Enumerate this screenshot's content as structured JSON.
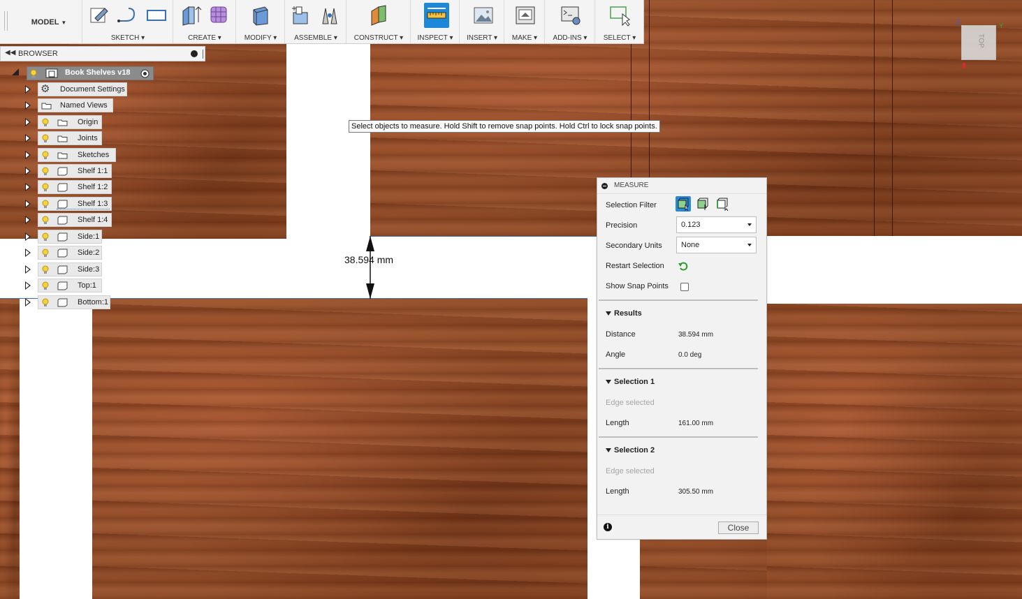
{
  "toolbar": {
    "workspace": "MODEL",
    "groups": [
      "SKETCH",
      "CREATE",
      "MODIFY",
      "ASSEMBLE",
      "CONSTRUCT",
      "INSPECT",
      "INSERT",
      "MAKE",
      "ADD-INS",
      "SELECT"
    ]
  },
  "browser": {
    "title": "BROWSER",
    "root": "Book Shelves v18",
    "items": [
      {
        "label": "Document Settings"
      },
      {
        "label": "Named Views"
      },
      {
        "label": "Origin"
      },
      {
        "label": "Joints"
      },
      {
        "label": "Sketches"
      },
      {
        "label": "Shelf 1:1"
      },
      {
        "label": "Shelf 1:2"
      },
      {
        "label": "Shelf 1:3"
      },
      {
        "label": "Shelf 1:4"
      },
      {
        "label": "Side:1"
      },
      {
        "label": "Side:2"
      },
      {
        "label": "Side:3"
      },
      {
        "label": "Top:1"
      },
      {
        "label": "Bottom:1"
      }
    ]
  },
  "tooltip": "Select objects to measure. Hold Shift to remove snap points. Hold Ctrl to lock snap points.",
  "dimension": "38.594 mm",
  "measure": {
    "title": "MEASURE",
    "selection_filter_label": "Selection Filter",
    "precision_label": "Precision",
    "precision_value": "0.123",
    "secondary_units_label": "Secondary Units",
    "secondary_units_value": "None",
    "restart_label": "Restart Selection",
    "snap_label": "Show Snap Points",
    "results": {
      "title": "Results",
      "distance_label": "Distance",
      "distance_value": "38.594 mm",
      "angle_label": "Angle",
      "angle_value": "0.0 deg"
    },
    "selection1": {
      "title": "Selection 1",
      "type": "Edge selected",
      "length_label": "Length",
      "length_value": "161.00 mm"
    },
    "selection2": {
      "title": "Selection 2",
      "type": "Edge selected",
      "length_label": "Length",
      "length_value": "305.50 mm"
    },
    "close_label": "Close"
  },
  "viewcube": {
    "face": "TOP",
    "axis_z": "Z",
    "axis_y": "Y"
  },
  "colors": {
    "accent": "#1e88d8",
    "wood": "#8f4a26"
  }
}
